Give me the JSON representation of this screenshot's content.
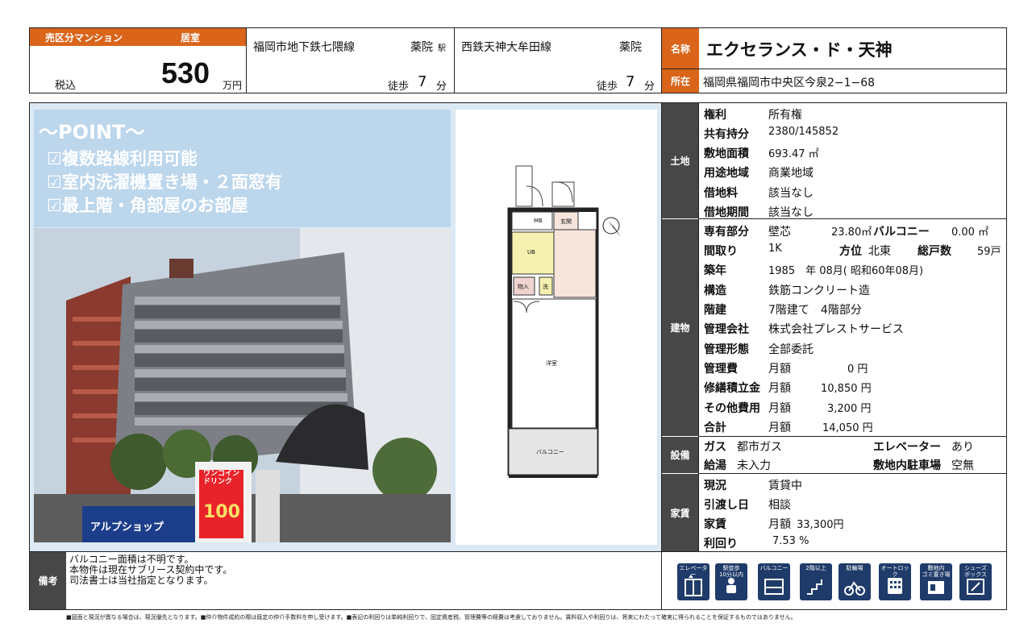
{
  "header": {
    "category": "売区分マンション",
    "property_type": "居室",
    "tax_label": "税込",
    "price": "530",
    "price_unit": "万円",
    "station1": {
      "line": "福岡市地下鉄七隈線",
      "station": "薬院",
      "eki": "駅",
      "walk_label": "徒歩",
      "walk_min": "7",
      "min_unit": "分"
    },
    "station2": {
      "line": "西鉄天神大牟田線",
      "station": "薬院",
      "walk_label": "徒歩",
      "walk_min": "7",
      "min_unit": "分"
    },
    "name_label": "名称",
    "name": "エクセランス・ド・天神",
    "address_label": "所在",
    "address": "福岡県福岡市中央区今泉2−1−68"
  },
  "point": {
    "title": "〜POINT〜",
    "items": [
      "☑複数路線利用可能",
      "☑室内洗濯機置き場・２面窓有",
      "☑最上階・角部屋のお部屋"
    ]
  },
  "photo": {
    "sign1": "ワンコイン\nドリンク",
    "sign2": "100",
    "shop": "アルプショップ"
  },
  "floorplan": {
    "mb": "MB",
    "genkan": "玄関",
    "ub": "UB",
    "mono": "物入",
    "sen": "洗",
    "yoshitsu": "洋室",
    "balcony": "バルコニー"
  },
  "land": {
    "section": "土地",
    "rows": [
      {
        "label": "権利",
        "value": "所有権"
      },
      {
        "label": "共有持分",
        "value": "2380/145852"
      },
      {
        "label": "敷地面積",
        "value": "693.47 ㎡"
      },
      {
        "label": "用途地域",
        "value": "商業地域"
      },
      {
        "label": "借地料",
        "value": "該当なし"
      },
      {
        "label": "借地期間",
        "value": "該当なし"
      }
    ]
  },
  "building": {
    "section": "建物",
    "senyu_label": "専有部分",
    "senyu_type": "壁芯",
    "senyu_area": "23.80㎡",
    "balcony_label": "バルコニー",
    "balcony_area": "0.00 ㎡",
    "madori_label": "間取り",
    "madori": "1K",
    "houi_label": "方位",
    "houi": "北東",
    "soko_label": "総戸数",
    "soko": "59戸",
    "chiku_label": "築年",
    "chiku": "1985　年 08月( 昭和60年08月)",
    "kozo_label": "構造",
    "kozo": "鉄筋コンクリート造",
    "kaidate_label": "階建",
    "kaidate": "7階建て　4階部分",
    "kanrigaisha_label": "管理会社",
    "kanrigaisha": "株式会社プレストサービス",
    "kanrikeitai_label": "管理形態",
    "kanrikeitai": "全部委託",
    "kanrihi_label": "管理費",
    "kanrihi_period": "月額",
    "kanrihi": "0 円",
    "shuzen_label": "修繕積立金",
    "shuzen_period": "月額",
    "shuzen": "10,850 円",
    "sonota_label": "その他費用",
    "sonota_period": "月額",
    "sonota": "3,200 円",
    "total_label": "合計",
    "total_period": "月額",
    "total": "14,050 円"
  },
  "equipment": {
    "section": "設備",
    "gas_label": "ガス",
    "gas": "都市ガス",
    "elevator_label": "エレベーター",
    "elevator": "あり",
    "kyuto_label": "給湯",
    "kyuto": "未入力",
    "parking_label": "敷地内駐車場",
    "parking": "空無"
  },
  "rent": {
    "section": "家賃",
    "genkyo_label": "現況",
    "genkyo": "賃貸中",
    "hikiwatashi_label": "引渡し日",
    "hikiwatashi": "相談",
    "yachin_label": "家賃",
    "yachin_period": "月額",
    "yachin": "33,300円",
    "rimawari_label": "利回り",
    "rimawari": "7.53 %"
  },
  "remarks": {
    "label": "備考",
    "lines": [
      "バルコニー面積は不明です。",
      "本物件は現在サブリース契約中です。",
      "司法書士は当社指定となります。"
    ]
  },
  "icons": [
    {
      "name": "elevator-icon",
      "caption": "エレベーター"
    },
    {
      "name": "station-walk-icon",
      "caption": "駅徒歩\n10分以内"
    },
    {
      "name": "balcony-icon",
      "caption": "バルコニー"
    },
    {
      "name": "second-floor-icon",
      "caption": "2階以上"
    },
    {
      "name": "bicycle-parking-icon",
      "caption": "駐輪場"
    },
    {
      "name": "autolock-icon",
      "caption": "オートロック"
    },
    {
      "name": "garbage-icon",
      "caption": "敷地内\nゴミ置き場"
    },
    {
      "name": "shoebox-icon",
      "caption": "シューズ\nボックス"
    }
  ],
  "footer": "■図面と現況が異なる場合は、現況優先となります。■仲介物件成約の際は既定の仲介手数料を申し受けます。■表記の利回りは単純利回りで、固定資産税、管理費等の経費は考慮しておりません。賃料収入や利回りは、将来にわたって確実に得られることを保証するものではありません。",
  "colors": {
    "accent": "#d9641a",
    "section_bg": "#474747",
    "icon_bg": "#1f3b69",
    "point_bg": "#bcd6ec"
  }
}
